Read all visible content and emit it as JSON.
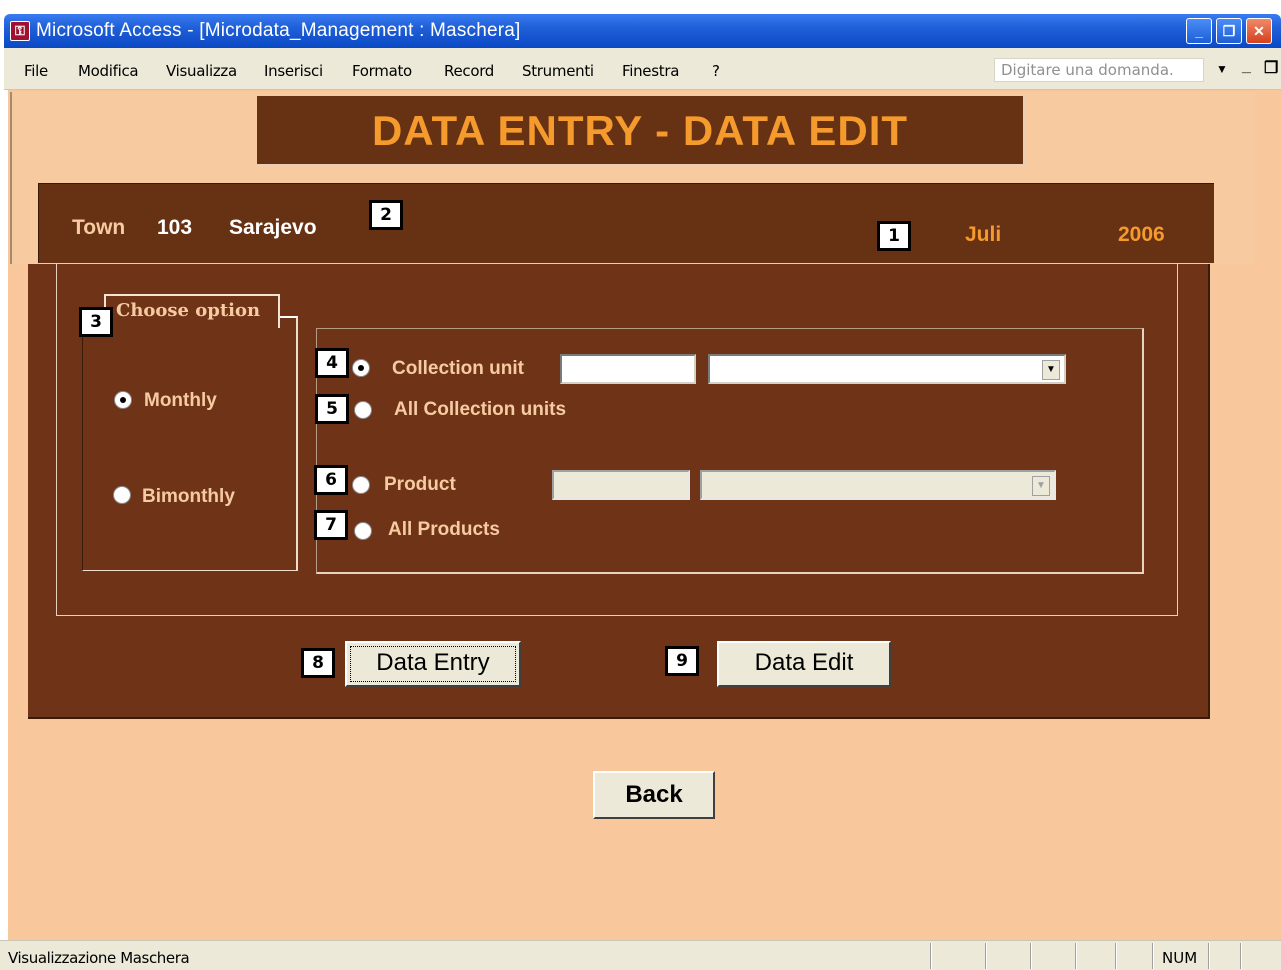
{
  "window": {
    "title": "Microsoft Access - [Microdata_Management : Maschera]",
    "controls": {
      "minimize": "_",
      "restore": "❐",
      "close": "✕"
    }
  },
  "menubar": {
    "items": [
      "File",
      "Modifica",
      "Visualizza",
      "Inserisci",
      "Formato",
      "Record",
      "Strumenti",
      "Finestra",
      "?"
    ],
    "ask_placeholder": "Digitare una domanda."
  },
  "form": {
    "title": "DATA ENTRY - DATA EDIT",
    "town_label": "Town",
    "town_code": "103",
    "town_name": "Sarajevo",
    "month": "Juli",
    "year": "2006",
    "option_group_label": "Choose option",
    "frequency_options": [
      {
        "label": "Monthly",
        "checked": true
      },
      {
        "label": "Bimonthly",
        "checked": false
      }
    ],
    "unit_options": {
      "collection_unit": "Collection unit",
      "all_collection_units": "All Collection units",
      "product": "Product",
      "all_products": "All Products"
    },
    "collection_unit_code": "",
    "collection_unit_name": "",
    "product_code": "",
    "product_name": "",
    "buttons": {
      "data_entry": "Data Entry",
      "data_edit": "Data Edit",
      "back": "Back"
    }
  },
  "badges": [
    "1",
    "2",
    "3",
    "4",
    "5",
    "6",
    "7",
    "8",
    "9"
  ],
  "statusbar": {
    "text": "Visualizzazione Maschera",
    "num": "NUM"
  },
  "colors": {
    "title_bar": "#0a49c4",
    "form_background": "#f8c89c",
    "panel_brown": "#6f3418",
    "title_orange": "#f59a2c",
    "label_peach": "#f7cba2",
    "value_white": "#ffffff"
  }
}
